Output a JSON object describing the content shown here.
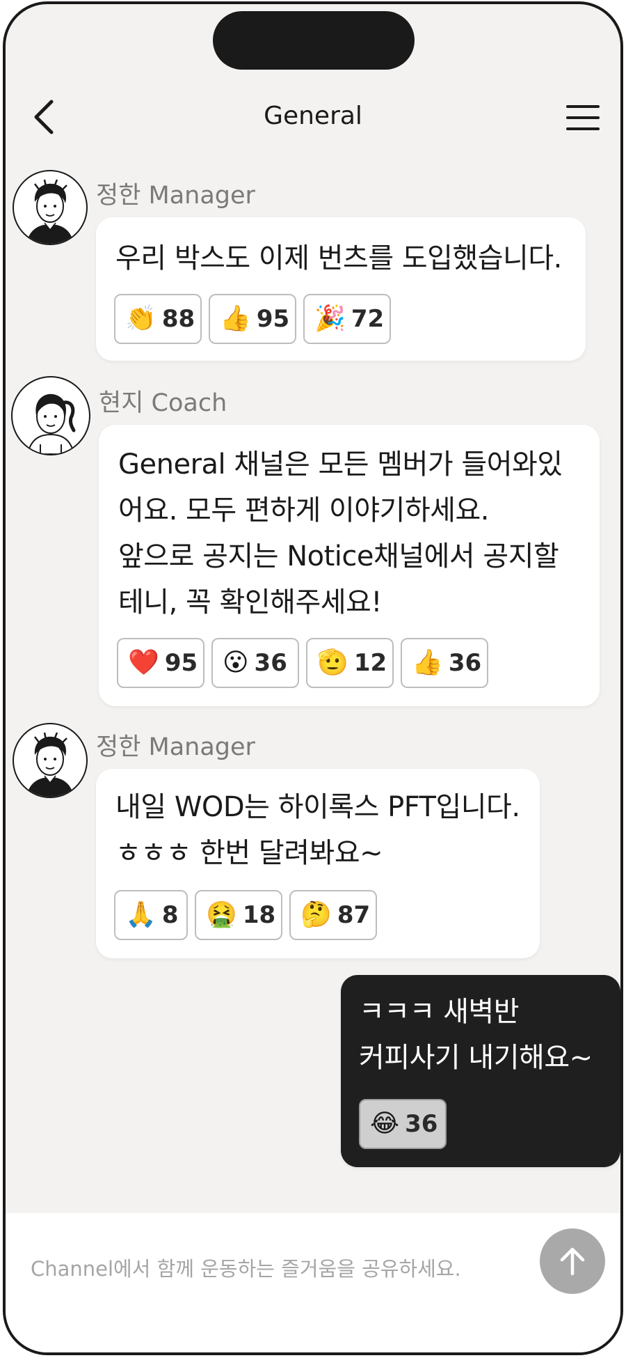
{
  "header": {
    "title": "General"
  },
  "icons": {
    "back": "chevron-left-icon",
    "menu": "hamburger-menu-icon",
    "send": "arrow-up-icon"
  },
  "messages": [
    {
      "sender": "정한 Manager",
      "text": "우리 박스도 이제 번츠를 도입했습니다.",
      "reactions": [
        {
          "emoji": "👏",
          "count": "88"
        },
        {
          "emoji": "👍",
          "count": "95"
        },
        {
          "emoji": "🎉",
          "count": "72"
        }
      ]
    },
    {
      "sender": "현지 Coach",
      "text": "General 채널은 모든 멤버가 들어와있\n어요. 모두 편하게 이야기하세요.\n앞으로 공지는 Notice채널에서 공지할\n테니, 꼭 확인해주세요!",
      "reactions": [
        {
          "emoji": "❤️",
          "count": "95"
        },
        {
          "emoji": "😮",
          "count": "36"
        },
        {
          "emoji": "🫡",
          "count": "12"
        },
        {
          "emoji": "👍",
          "count": "36"
        }
      ]
    },
    {
      "sender": "정한 Manager",
      "text": "내일 WOD는 하이록스 PFT입니다.\nㅎㅎㅎ 한번 달려봐요~",
      "reactions": [
        {
          "emoji": "🙏",
          "count": "8"
        },
        {
          "emoji": "🤮",
          "count": "18"
        },
        {
          "emoji": "🤔",
          "count": "87"
        }
      ]
    },
    {
      "sender": "",
      "text": "ㅋㅋㅋ 새벽반\n커피사기 내기해요~",
      "reactions": [
        {
          "emoji": "😂",
          "count": "36"
        }
      ]
    }
  ],
  "composer": {
    "placeholder": "Channel에서 함께 운동하는 즐거움을 공유하세요."
  },
  "colors": {
    "background": "#f3f2f0",
    "my_bubble": "#1f1f1f",
    "send_button": "#a9a9a9"
  }
}
